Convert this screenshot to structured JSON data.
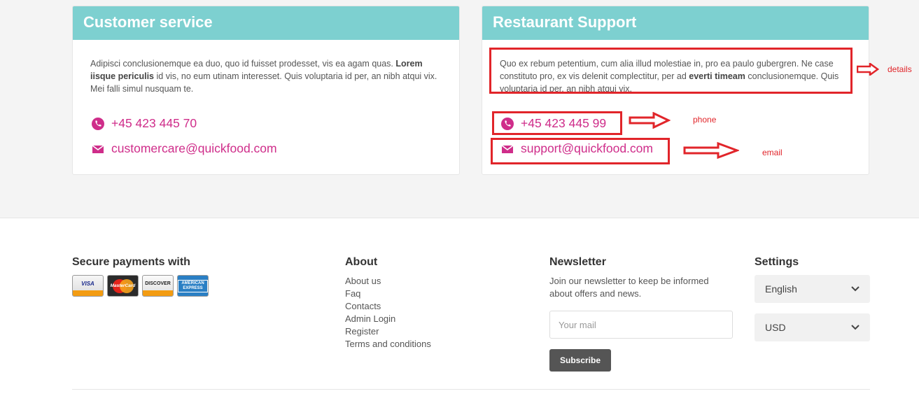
{
  "customer_service": {
    "title": "Customer service",
    "text_plain1": "Adipisci conclusionemque ea duo, quo id fuisset prodesset, vis ea agam quas. ",
    "text_bold": "Lorem iisque periculis",
    "text_plain2": " id vis, no eum utinam interesset. Quis voluptaria id per, an nibh atqui vix. Mei falli simul nusquam te.",
    "phone": "+45 423 445 70",
    "email": "customercare@quickfood.com",
    "phone_icon": "phone-icon",
    "email_icon": "envelope-icon"
  },
  "restaurant_support": {
    "title": "Restaurant Support",
    "text_plain1": "Quo ex rebum petentium, cum alia illud molestiae in, pro ea paulo gubergren. Ne case constituto pro, ex vis delenit complectitur, per ad ",
    "text_bold": "everti timeam",
    "text_plain2": " conclusionemque. Quis voluptaria id per, an nibh atqui vix.",
    "phone": "+45 423 445 99",
    "email": "support@quickfood.com",
    "phone_icon": "phone-icon",
    "email_icon": "envelope-icon"
  },
  "annotations": {
    "details": "details",
    "phone": "phone",
    "email": "email",
    "color": "#e1252a"
  },
  "footer": {
    "payments": {
      "heading": "Secure payments with",
      "cards": [
        "VISA",
        "MasterCard",
        "DISCOVER",
        "AMERICAN EXPRESS"
      ]
    },
    "about": {
      "heading": "About",
      "links": [
        "About us",
        "Faq",
        "Contacts",
        "Admin Login",
        "Register",
        "Terms and conditions"
      ]
    },
    "newsletter": {
      "heading": "Newsletter",
      "text": "Join our newsletter to keep be informed about offers and news.",
      "placeholder": "Your mail",
      "button": "Subscribe"
    },
    "settings": {
      "heading": "Settings",
      "language": "English",
      "currency": "USD"
    }
  },
  "colors": {
    "header_teal": "#7dd0d0",
    "accent_pink": "#cf2d8a",
    "background": "#f4f4f4"
  }
}
